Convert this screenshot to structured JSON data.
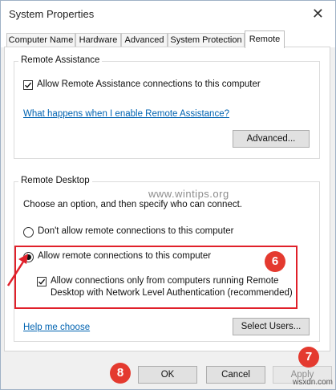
{
  "window": {
    "title": "System Properties",
    "close_glyph": "✕"
  },
  "tabs": [
    {
      "label": "Computer Name",
      "active": false
    },
    {
      "label": "Hardware",
      "active": false
    },
    {
      "label": "Advanced",
      "active": false
    },
    {
      "label": "System Protection",
      "active": false
    },
    {
      "label": "Remote",
      "active": true
    }
  ],
  "remote_assistance": {
    "group_title": "Remote Assistance",
    "allow_checkbox": {
      "label": "Allow Remote Assistance connections to this computer",
      "checked": true
    },
    "help_link": "What happens when I enable Remote Assistance?",
    "advanced_button": "Advanced..."
  },
  "remote_desktop": {
    "group_title": "Remote Desktop",
    "instruction": "Choose an option, and then specify who can connect.",
    "options": [
      {
        "label": "Don't allow remote connections to this computer",
        "selected": false
      },
      {
        "label": "Allow remote connections to this computer",
        "selected": true
      }
    ],
    "nla_checkbox": {
      "line1": "Allow connections only from computers running Remote",
      "line2": "Desktop with Network Level Authentication (recommended)",
      "checked": true
    },
    "help_link": "Help me choose",
    "select_users_button": "Select Users..."
  },
  "footer": {
    "ok": "OK",
    "cancel": "Cancel",
    "apply": "Apply"
  },
  "annotations": {
    "step6": "6",
    "step7": "7",
    "step8": "8",
    "badge_color": "#e43a2f",
    "highlight_color": "#e0202a"
  },
  "watermarks": {
    "center": "www.wintips.org",
    "corner": "wsxdn.com"
  }
}
